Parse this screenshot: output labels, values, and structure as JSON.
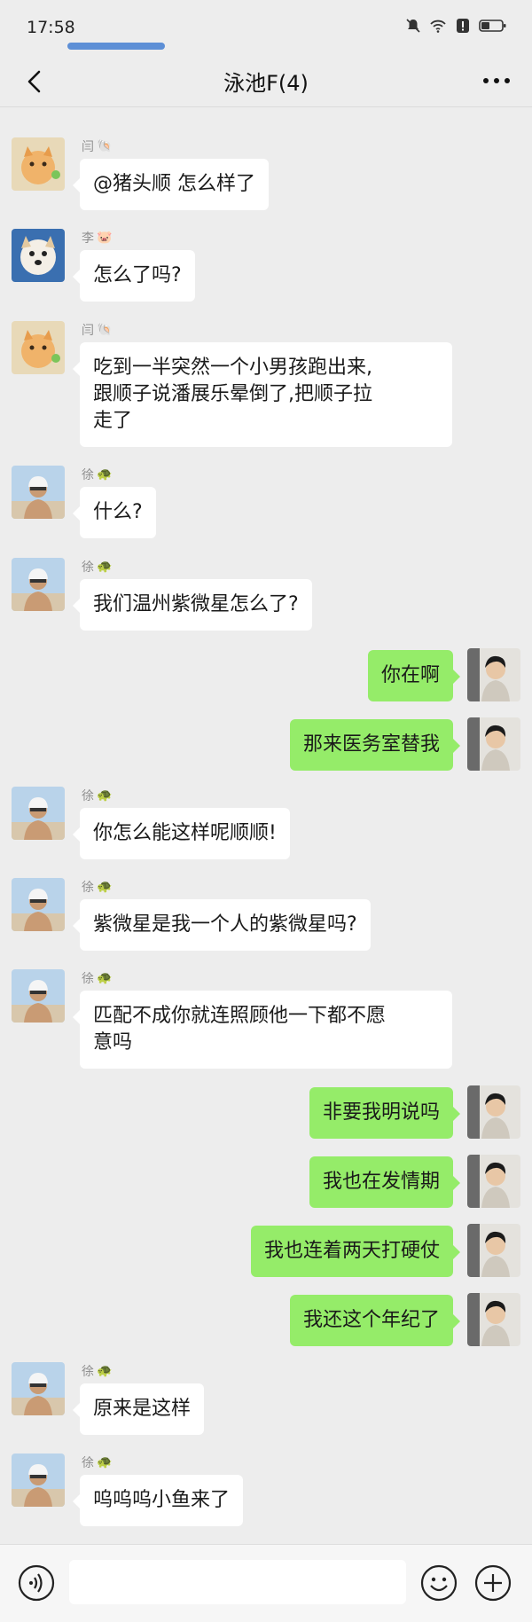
{
  "status_bar": {
    "time": "17:58"
  },
  "nav": {
    "title": "泳池F(4)"
  },
  "input_bar": {
    "placeholder": ""
  },
  "messages": [
    {
      "side": "in",
      "sender": "闫",
      "avatar": "cat-avatar",
      "text": "@猪头顺 怎么样了"
    },
    {
      "side": "in",
      "sender": "李",
      "avatar": "dog-avatar",
      "text": "怎么了吗?"
    },
    {
      "side": "in",
      "sender": "闫",
      "avatar": "cat-avatar",
      "text": "吃到一半突然一个小男孩跑出来,\n跟顺子说潘展乐晕倒了,把顺子拉\n走了"
    },
    {
      "side": "in",
      "sender": "徐",
      "avatar": "swimmer-avatar",
      "text": "什么?"
    },
    {
      "side": "in",
      "sender": "徐",
      "avatar": "swimmer-avatar",
      "text": "我们温州紫微星怎么了?"
    },
    {
      "side": "out",
      "sender": "",
      "avatar": "man-avatar",
      "text": "你在啊"
    },
    {
      "side": "out",
      "sender": "",
      "avatar": "man-avatar",
      "text": "那来医务室替我"
    },
    {
      "side": "in",
      "sender": "徐",
      "avatar": "swimmer-avatar",
      "text": "你怎么能这样呢顺顺!"
    },
    {
      "side": "in",
      "sender": "徐",
      "avatar": "swimmer-avatar",
      "text": "紫微星是我一个人的紫微星吗?"
    },
    {
      "side": "in",
      "sender": "徐",
      "avatar": "swimmer-avatar",
      "text": "匹配不成你就连照顾他一下都不愿\n意吗"
    },
    {
      "side": "out",
      "sender": "",
      "avatar": "man-avatar",
      "text": "非要我明说吗"
    },
    {
      "side": "out",
      "sender": "",
      "avatar": "man-avatar",
      "text": "我也在发情期"
    },
    {
      "side": "out",
      "sender": "",
      "avatar": "man-avatar",
      "text": "我也连着两天打硬仗"
    },
    {
      "side": "out",
      "sender": "",
      "avatar": "man-avatar",
      "text": "我还这个年纪了"
    },
    {
      "side": "in",
      "sender": "徐",
      "avatar": "swimmer-avatar",
      "text": "原来是这样"
    },
    {
      "side": "in",
      "sender": "徐",
      "avatar": "swimmer-avatar",
      "text": "呜呜呜小鱼来了"
    }
  ]
}
